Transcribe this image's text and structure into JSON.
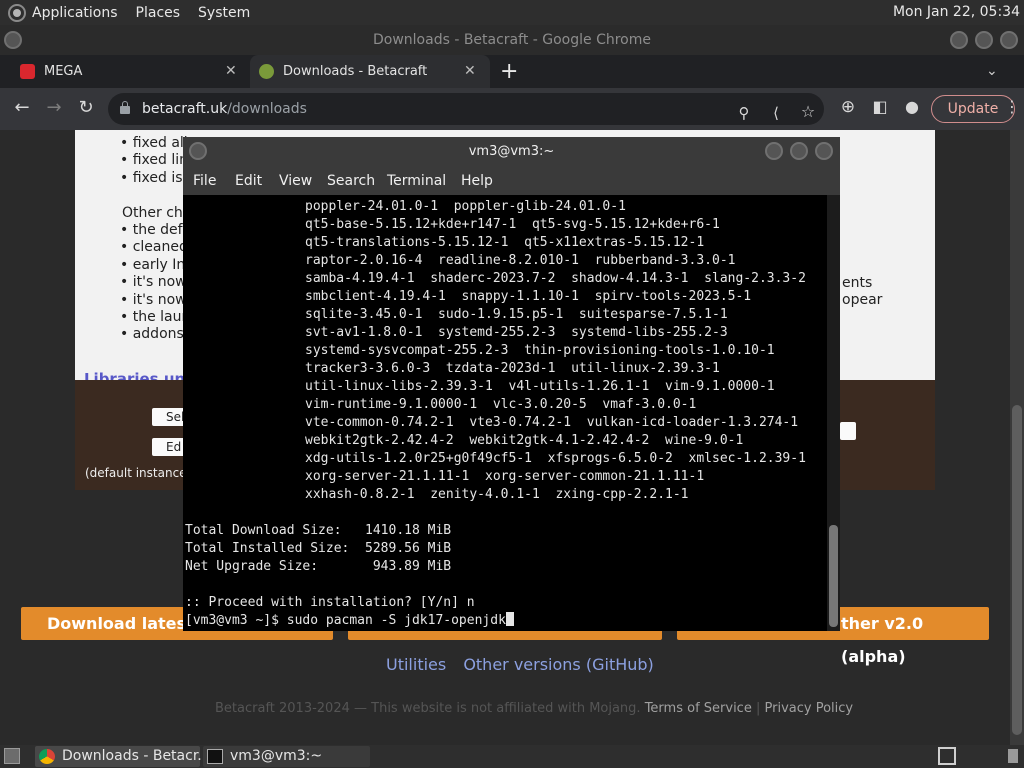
{
  "topbar": {
    "menus": [
      "Applications",
      "Places",
      "System"
    ],
    "clock": "Mon Jan 22, 05:34"
  },
  "chrome": {
    "window_title": "Downloads - Betacraft - Google Chrome",
    "tabs": [
      {
        "title": "MEGA",
        "active": false
      },
      {
        "title": "Downloads - Betacraft",
        "active": true
      }
    ],
    "url_host": "betacraft.uk",
    "url_path": "/downloads",
    "update_label": "Update"
  },
  "page": {
    "bullets_group1": [
      "fixed all",
      "fixed linu",
      "fixed iss"
    ],
    "other_changes_label": "Other cha",
    "bullets_group2": [
      "the defa",
      "cleaned",
      "early Inc",
      "it's now",
      "it's now",
      "the launc",
      "addons"
    ],
    "right_snippets": [
      "ents",
      "opear"
    ],
    "libraries_heading": "Libraries und",
    "button1": "Sel",
    "button2": "Ed",
    "default_instance_note": "(default instance",
    "download_buttons": [
      "Download latest V",
      "ther v2.0 (alpha)"
    ],
    "footer_links": [
      "Utilities",
      "Other versions (GitHub)"
    ],
    "footer_text": "Betacraft 2013-2024 — This website is not affiliated with Mojang.",
    "terms_link": "Terms of Service",
    "footer_separator": "|",
    "privacy_link": "Privacy Policy"
  },
  "terminal": {
    "title": "vm3@vm3:~",
    "menu": [
      "File",
      "Edit",
      "View",
      "Search",
      "Terminal",
      "Help"
    ],
    "packages": [
      "poppler-24.01.0-1  poppler-glib-24.01.0-1",
      "qt5-base-5.15.12+kde+r147-1  qt5-svg-5.15.12+kde+r6-1",
      "qt5-translations-5.15.12-1  qt5-x11extras-5.15.12-1",
      "raptor-2.0.16-4  readline-8.2.010-1  rubberband-3.3.0-1",
      "samba-4.19.4-1  shaderc-2023.7-2  shadow-4.14.3-1  slang-2.3.3-2",
      "smbclient-4.19.4-1  snappy-1.1.10-1  spirv-tools-2023.5-1",
      "sqlite-3.45.0-1  sudo-1.9.15.p5-1  suitesparse-7.5.1-1",
      "svt-av1-1.8.0-1  systemd-255.2-3  systemd-libs-255.2-3",
      "systemd-sysvcompat-255.2-3  thin-provisioning-tools-1.0.10-1",
      "tracker3-3.6.0-3  tzdata-2023d-1  util-linux-2.39.3-1",
      "util-linux-libs-2.39.3-1  v4l-utils-1.26.1-1  vim-9.1.0000-1",
      "vim-runtime-9.1.0000-1  vlc-3.0.20-5  vmaf-3.0.0-1",
      "vte-common-0.74.2-1  vte3-0.74.2-1  vulkan-icd-loader-1.3.274-1",
      "webkit2gtk-2.42.4-2  webkit2gtk-4.1-2.42.4-2  wine-9.0-1",
      "xdg-utils-1.2.0r25+g0f49cf5-1  xfsprogs-6.5.0-2  xmlsec-1.2.39-1",
      "xorg-server-21.1.11-1  xorg-server-common-21.1.11-1",
      "xxhash-0.8.2-1  zenity-4.0.1-1  zxing-cpp-2.2.1-1"
    ],
    "summary": [
      "Total Download Size:   1410.18 MiB",
      "Total Installed Size:  5289.56 MiB",
      "Net Upgrade Size:       943.89 MiB"
    ],
    "prompt_line": ":: Proceed with installation? [Y/n] n",
    "command_line": "[vm3@vm3 ~]$ sudo pacman -S jdk17-openjdk"
  },
  "taskbar": {
    "items": [
      "Downloads - Betacr...",
      "vm3@vm3:~"
    ]
  },
  "colors": {
    "accent_orange": "#e38b2b",
    "update_border": "#d08d8d",
    "link_blue": "#8ca0e0"
  }
}
